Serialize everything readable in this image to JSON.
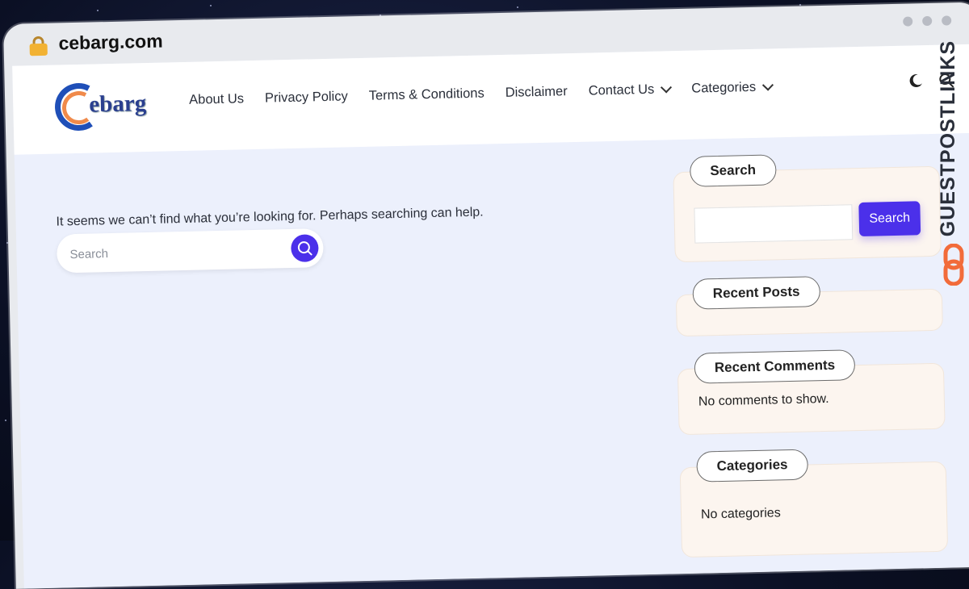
{
  "browser": {
    "url": "cebarg.com"
  },
  "site": {
    "logo_text": "ebarg",
    "nav": [
      {
        "label": "About Us"
      },
      {
        "label": "Privacy Policy"
      },
      {
        "label": "Terms & Conditions"
      },
      {
        "label": "Disclaimer"
      },
      {
        "label": "Contact Us",
        "dropdown": true
      },
      {
        "label": "Categories",
        "dropdown": true
      }
    ]
  },
  "main": {
    "message": "It seems we can’t find what you’re looking for. Perhaps searching can help.",
    "search_placeholder": "Search"
  },
  "sidebar": {
    "search_title": "Search",
    "search_button": "Search",
    "recent_posts_title": "Recent Posts",
    "recent_comments_title": "Recent Comments",
    "recent_comments_text": "No comments to show.",
    "categories_title": "Categories",
    "categories_text": "No categories"
  },
  "watermark": "GUESTPOSTLINKS",
  "colors": {
    "accent": "#4b30ea",
    "page_bg": "#ecf0fc",
    "widget_bg": "#fcf5ef",
    "watermark_icon": "#f26b3a"
  }
}
